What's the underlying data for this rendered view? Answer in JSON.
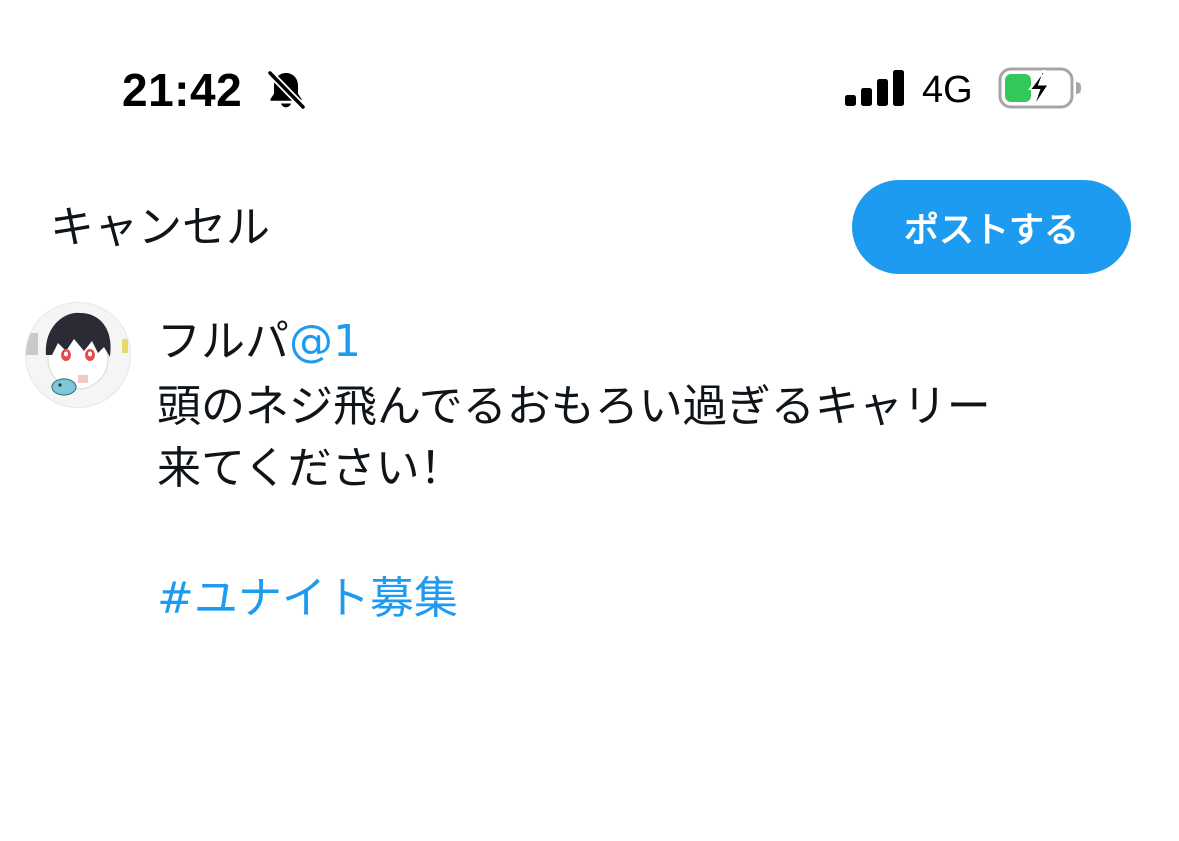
{
  "status_bar": {
    "time": "21:42",
    "network": "4G",
    "battery_color": "#34c759"
  },
  "compose": {
    "cancel_label": "キャンセル",
    "post_label": "ポストする",
    "accent_color": "#1d9bf0"
  },
  "author": {
    "name": "フルパ",
    "handle": "@1"
  },
  "post": {
    "lines": [
      "頭のネジ飛んでるおもろい過ぎるキャリー",
      "来てください！"
    ],
    "hashtag": "#ユナイト募集"
  },
  "icons": {
    "silent": "bell-slash-icon",
    "signal": "cellular-signal-icon",
    "battery": "battery-charging-icon"
  }
}
